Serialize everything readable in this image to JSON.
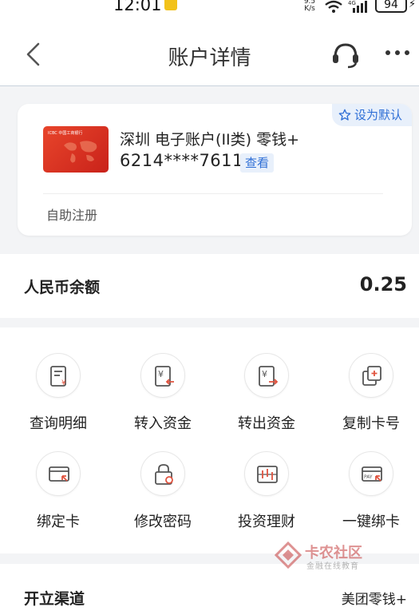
{
  "status_bar": {
    "time": "12:01",
    "speed": "9.5\nK/s",
    "network": "4G",
    "battery": "94"
  },
  "nav": {
    "title": "账户详情"
  },
  "account_card": {
    "default_label": "设为默认",
    "name": "深圳 电子账户(II类) 零钱+",
    "number": "6214****7611",
    "view_label": "查看",
    "register_note": "自助注册",
    "card_logo_text": "ICBC 中国工商银行"
  },
  "balance": {
    "label": "人民币余额",
    "value": "0.25"
  },
  "actions": [
    {
      "label": "查询明细"
    },
    {
      "label": "转入资金"
    },
    {
      "label": "转出资金"
    },
    {
      "label": "复制卡号"
    },
    {
      "label": "绑定卡"
    },
    {
      "label": "修改密码"
    },
    {
      "label": "投资理财"
    },
    {
      "label": "一键绑卡"
    }
  ],
  "channel": {
    "label": "开立渠道",
    "value": "美团零钱+"
  },
  "watermark": {
    "name": "卡农社区",
    "tagline": "金融在线教育"
  },
  "colors": {
    "accent_blue": "#2f6fd6",
    "icon_red": "#e0533f",
    "card_red": "#d9321f"
  }
}
